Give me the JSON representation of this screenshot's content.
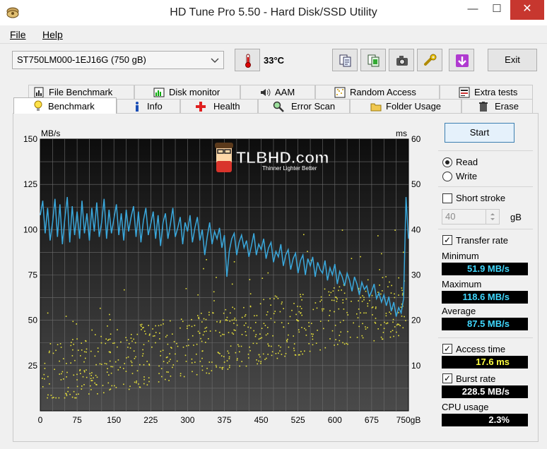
{
  "window": {
    "title": "HD Tune Pro 5.50 - Hard Disk/SSD Utility",
    "minimize": "—",
    "maximize": "☐",
    "close": "✕"
  },
  "menu": {
    "file": "File",
    "help": "Help"
  },
  "toolbar": {
    "drive": "ST750LM000-1EJ16G (750 gB)",
    "temperature": "33°C",
    "exit": "Exit"
  },
  "tabs_row1": [
    {
      "label": "File Benchmark",
      "icon": "file-benchmark-icon"
    },
    {
      "label": "Disk monitor",
      "icon": "disk-monitor-icon"
    },
    {
      "label": "AAM",
      "icon": "speaker-icon"
    },
    {
      "label": "Random Access",
      "icon": "random-access-icon"
    },
    {
      "label": "Extra tests",
      "icon": "extra-tests-icon"
    }
  ],
  "tabs_row2": [
    {
      "label": "Benchmark",
      "icon": "benchmark-icon"
    },
    {
      "label": "Info",
      "icon": "info-icon"
    },
    {
      "label": "Health",
      "icon": "health-icon"
    },
    {
      "label": "Error Scan",
      "icon": "error-scan-icon"
    },
    {
      "label": "Folder Usage",
      "icon": "folder-icon"
    },
    {
      "label": "Erase",
      "icon": "trash-icon"
    }
  ],
  "watermark": {
    "text": "TLBHD.com",
    "tagline": "Thinner Lighter Better"
  },
  "controls": {
    "start": "Start",
    "read": "Read",
    "write": "Write",
    "mode_selected": "read",
    "short_stroke": "Short stroke",
    "short_stroke_checked": false,
    "short_stroke_value": "40",
    "short_stroke_unit": "gB",
    "transfer_rate": "Transfer rate",
    "transfer_rate_checked": true,
    "access_time": "Access time",
    "access_time_checked": true,
    "burst_rate": "Burst rate",
    "burst_rate_checked": true,
    "cpu_usage": "CPU usage"
  },
  "results": {
    "minimum_label": "Minimum",
    "minimum": "51.9 MB/s",
    "maximum_label": "Maximum",
    "maximum": "118.6 MB/s",
    "average_label": "Average",
    "average": "87.5 MB/s",
    "access_time": "17.6 ms",
    "burst_rate": "228.5 MB/s",
    "cpu_usage": "2.3%"
  },
  "colors": {
    "transfer_line": "#3aa8dc",
    "access_dots": "#e8e23a",
    "chart_bg_top": "#0d0d0d",
    "chart_bg_bottom": "#4a4a4a",
    "grid": "#6e6e6e"
  },
  "chart_data": {
    "type": "line",
    "left_axis_unit": "MB/s",
    "right_axis_unit": "ms",
    "x_unit_label": "750gB",
    "x_ticks": [
      "0",
      "75",
      "150",
      "225",
      "300",
      "375",
      "450",
      "525",
      "600",
      "675",
      "750gB"
    ],
    "y_left_ticks": [
      "150",
      "125",
      "100",
      "75",
      "50",
      "25"
    ],
    "y_right_ticks": [
      "60",
      "50",
      "40",
      "30",
      "20",
      "10"
    ],
    "xlim": [
      0,
      750
    ],
    "ylim_left": [
      0,
      150
    ],
    "ylim_right": [
      0,
      60
    ],
    "grid": true,
    "series": [
      {
        "x": [
          0,
          5,
          10,
          15,
          20,
          25,
          30,
          35,
          40,
          45,
          50,
          55,
          60,
          65,
          70,
          75,
          80,
          85,
          90,
          95,
          100,
          105,
          110,
          115,
          120,
          125,
          130,
          135,
          140,
          145,
          150,
          155,
          160,
          165,
          170,
          175,
          180,
          185,
          190,
          195,
          200,
          205,
          210,
          215,
          220,
          225,
          230,
          235,
          240,
          245,
          250,
          255,
          260,
          265,
          270,
          275,
          280,
          285,
          290,
          295,
          300,
          305,
          310,
          315,
          320,
          325,
          330,
          335,
          340,
          345,
          350,
          355,
          360,
          365,
          370,
          375,
          380,
          385,
          390,
          395,
          400,
          405,
          410,
          415,
          420,
          425,
          430,
          435,
          440,
          445,
          450,
          455,
          460,
          465,
          470,
          475,
          480,
          485,
          490,
          495,
          500,
          505,
          510,
          515,
          520,
          525,
          530,
          535,
          540,
          545,
          550,
          555,
          560,
          565,
          570,
          575,
          580,
          585,
          590,
          595,
          600,
          605,
          610,
          615,
          620,
          625,
          630,
          635,
          640,
          645,
          650,
          655,
          660,
          665,
          670,
          675,
          680,
          685,
          690,
          695,
          700,
          705,
          710,
          715,
          720,
          725,
          730,
          735,
          740,
          745,
          750
        ],
        "values": [
          108,
          116,
          98,
          112,
          94,
          104,
          117,
          96,
          114,
          92,
          106,
          118,
          93,
          113,
          97,
          110,
          95,
          116,
          98,
          109,
          94,
          112,
          99,
          115,
          96,
          104,
          117,
          95,
          111,
          98,
          106,
          114,
          97,
          109,
          94,
          111,
          99,
          107,
          113,
          96,
          110,
          93,
          105,
          112,
          97,
          103,
          110,
          95,
          108,
          91,
          104,
          109,
          95,
          103,
          112,
          96,
          101,
          107,
          92,
          104,
          99,
          108,
          93,
          101,
          107,
          94,
          100,
          86,
          96,
          104,
          92,
          99,
          95,
          101,
          90,
          97,
          74,
          88,
          95,
          98,
          86,
          93,
          97,
          90,
          94,
          85,
          91,
          98,
          86,
          92,
          89,
          95,
          84,
          90,
          93,
          82,
          88,
          85,
          92,
          80,
          86,
          89,
          78,
          84,
          87,
          76,
          83,
          86,
          75,
          84,
          80,
          85,
          74,
          82,
          78,
          76,
          83,
          72,
          79,
          75,
          81,
          70,
          77,
          74,
          69,
          76,
          72,
          66,
          74,
          70,
          64,
          71,
          67,
          69,
          63,
          66,
          70,
          62,
          65,
          60,
          64,
          58,
          63,
          55,
          60,
          52,
          57,
          54,
          62,
          118,
          95
        ]
      }
    ]
  }
}
